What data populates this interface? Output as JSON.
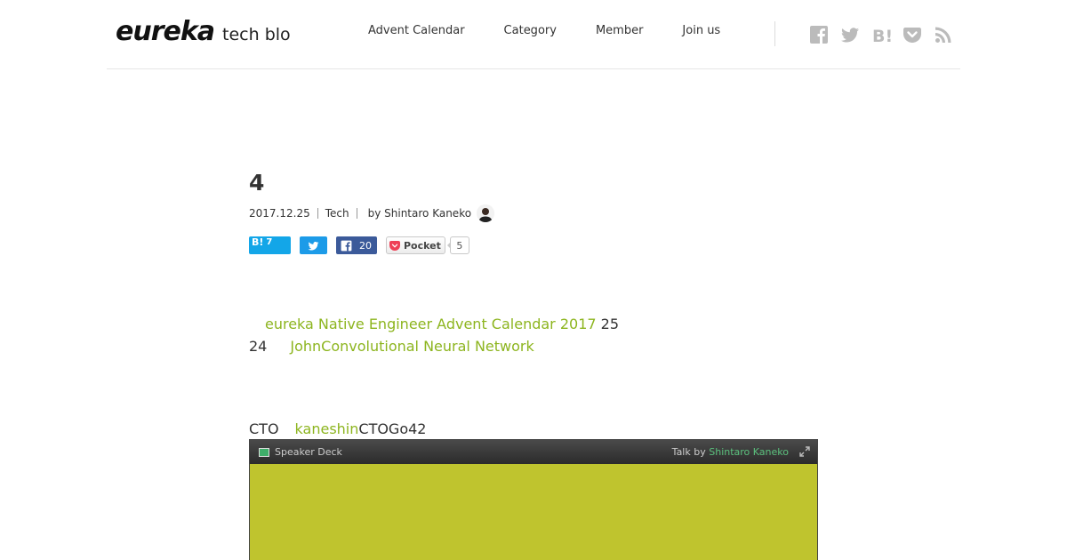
{
  "header": {
    "logo_word": "eureka",
    "logo_sub": "tech blog",
    "nav": [
      "Advent Calendar",
      "Category",
      "Member",
      "Join us"
    ],
    "social_icons": [
      "facebook-icon",
      "twitter-icon",
      "hatena-bookmark-icon",
      "pocket-icon",
      "rss-icon"
    ]
  },
  "article": {
    "title": "4",
    "date": "2017.12.25",
    "category": "Tech",
    "author": "by Shintaro Kaneko",
    "share": {
      "hatena_label": "B!",
      "hatena_count": "7",
      "facebook_count": "20",
      "pocket_label": "Pocket",
      "pocket_count": "5"
    },
    "body": {
      "link1": "eureka Native Engineer Advent Calendar 2017",
      "text1": " 25",
      "text2": "24",
      "link2": "JohnConvolutional Neural Network",
      "text3": "CTO",
      "link3": "kaneshin",
      "text4": "CTOGo42"
    },
    "deck": {
      "brand": "Speaker Deck",
      "talk_prefix": "Talk by ",
      "talk_author": "Shintaro Kaneko"
    }
  },
  "colors": {
    "link": "#8db51f",
    "hatena": "#13a6e8",
    "twitter": "#1c9be8",
    "facebook": "#3b5a9a",
    "slide": "#bfc42e"
  }
}
